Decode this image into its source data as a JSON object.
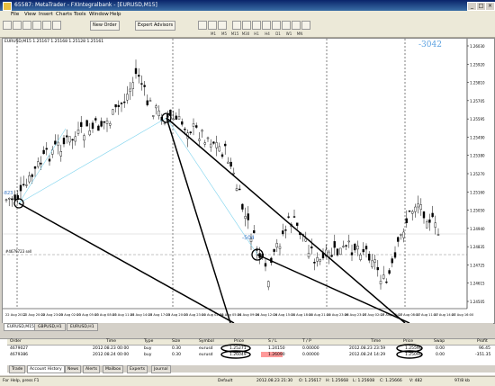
{
  "window": {
    "title": "65587: MetaTrader - FXIntegralbank - [EURUSD,M15]"
  },
  "menu": [
    "File",
    "View",
    "Insert",
    "Charts",
    "Tools",
    "Window",
    "Help"
  ],
  "toolbar": {
    "new_order": "New Order",
    "expert_advisors": "Expert Advisors",
    "timeframes": [
      "M1",
      "M5",
      "M15",
      "M30",
      "H1",
      "H4",
      "D1",
      "W1",
      "MN"
    ]
  },
  "chart": {
    "header": "EURUSD,M15  1.25167 1.25168 1.25128 1.25161",
    "annotation_top_right": "-3042",
    "annotation_mid": "-504",
    "annotation_left": "-823",
    "sl_label": "#4679723 sell",
    "price_axis": [
      "1.26030",
      "1.25920",
      "1.25810",
      "1.25705",
      "1.25595",
      "1.25490",
      "1.25380",
      "1.25270",
      "1.25160",
      "1.25050",
      "1.24940",
      "1.24835",
      "1.24725",
      "1.24615",
      "1.24505"
    ],
    "time_axis": [
      "22 Aug 2012",
      "22 Aug 20:00",
      "22 Aug 23:00",
      "23 Aug 02:00",
      "23 Aug 05:00",
      "23 Aug 08:00",
      "23 Aug 11:00",
      "23 Aug 14:00",
      "23 Aug 17:00",
      "23 Aug 20:00",
      "23 Aug 23:00",
      "24 Aug 02:00",
      "24 Aug 05:00",
      "24 Aug 09:00",
      "24 Aug 12:00",
      "24 Aug 15:00",
      "24 Aug 18:00",
      "24 Aug 21:00",
      "24 Aug 23:00",
      "26 Aug 23:00",
      "27 Aug 02:00",
      "27 Aug 05:00",
      "27 Aug 08:00",
      "27 Aug 11:00",
      "27 Aug 14:00",
      "27 Aug 16:00"
    ],
    "tabs": [
      "EURUSD,M15",
      "GBPUSD,H1",
      "EURUSD,H1"
    ]
  },
  "terminal": {
    "headers": {
      "order": "Order",
      "time": "Time",
      "type": "Type",
      "size": "Size",
      "symbol": "Symbol",
      "price": "Price",
      "sl": "S / L",
      "tp": "T / P",
      "time2": "Time",
      "price2": "Price",
      "swap": "Swap",
      "profit": "Profit"
    },
    "rows": [
      {
        "order": "4679027",
        "time": "2012.08.23 00:00",
        "type": "buy",
        "size": "0.30",
        "symbol": "eurusd",
        "price": "1.25271",
        "sl": "1.24150",
        "tp": "0.00000",
        "time2": "2012.08.23 23:59",
        "price2": "1.25590",
        "swap": "0.00",
        "profit": "96.45"
      },
      {
        "order": "4679386",
        "time": "2012.08.24 00:00",
        "type": "buy",
        "size": "0.30",
        "symbol": "eurusd",
        "price": "1.26049",
        "sl": "1.26090",
        "tp": "0.00000",
        "time2": "2012.08.24 14:29",
        "price2": "1.25090",
        "swap": "0.00",
        "profit": "-351.35"
      }
    ],
    "tabs": [
      "Trade",
      "Account History",
      "News",
      "Alerts",
      "Mailbox",
      "Experts",
      "Journal"
    ]
  },
  "status": {
    "help": "For Help, press F1",
    "profile": "Default",
    "datetime": "2012.08.23 21:30",
    "open": "O: 1.25617",
    "high": "H: 1.25668",
    "low": "L: 1.25608",
    "close": "C: 1.25666",
    "volume": "V: 482",
    "traffic": "97/8 kb"
  }
}
